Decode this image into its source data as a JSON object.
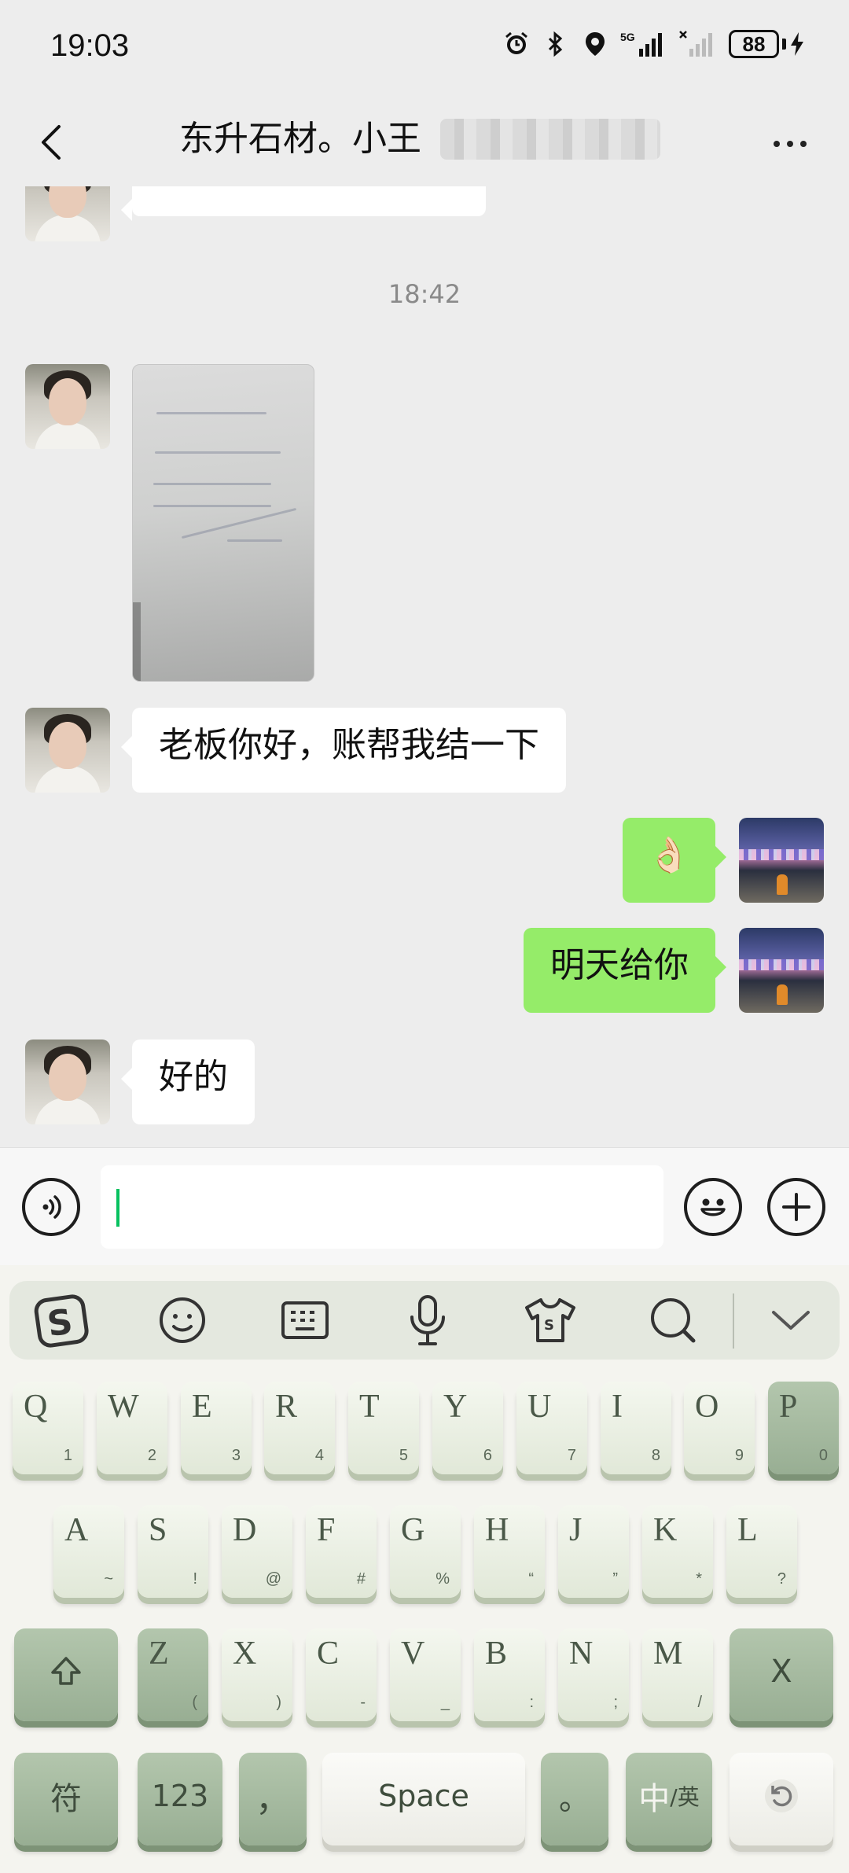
{
  "status_bar": {
    "time": "19:03",
    "battery": "88",
    "network": "5G"
  },
  "header": {
    "title": "东升石材。小王"
  },
  "chat": {
    "timestamp": "18:42",
    "messages": [
      {
        "side": "left",
        "type": "image",
        "content": "handwritten receipt photo"
      },
      {
        "side": "left",
        "type": "text",
        "text": "老板你好，账帮我结一下"
      },
      {
        "side": "right",
        "type": "emoji",
        "text": "👌🏻"
      },
      {
        "side": "right",
        "type": "text",
        "text": "明天给你"
      },
      {
        "side": "left",
        "type": "text",
        "text": "好的"
      }
    ]
  },
  "input_bar": {
    "value": "",
    "placeholder": ""
  },
  "keyboard": {
    "row1": [
      {
        "main": "Q",
        "sub": "1"
      },
      {
        "main": "W",
        "sub": "2"
      },
      {
        "main": "E",
        "sub": "3"
      },
      {
        "main": "R",
        "sub": "4"
      },
      {
        "main": "T",
        "sub": "5"
      },
      {
        "main": "Y",
        "sub": "6"
      },
      {
        "main": "U",
        "sub": "7"
      },
      {
        "main": "I",
        "sub": "8"
      },
      {
        "main": "O",
        "sub": "9"
      },
      {
        "main": "P",
        "sub": "0"
      }
    ],
    "row2": [
      {
        "main": "A",
        "sub": "~"
      },
      {
        "main": "S",
        "sub": "!"
      },
      {
        "main": "D",
        "sub": "@"
      },
      {
        "main": "F",
        "sub": "#"
      },
      {
        "main": "G",
        "sub": "%"
      },
      {
        "main": "H",
        "sub": "“"
      },
      {
        "main": "J",
        "sub": "”"
      },
      {
        "main": "K",
        "sub": "*"
      },
      {
        "main": "L",
        "sub": "?"
      }
    ],
    "row3": [
      {
        "main": "Z",
        "sub": "("
      },
      {
        "main": "X",
        "sub": ")"
      },
      {
        "main": "C",
        "sub": "-"
      },
      {
        "main": "V",
        "sub": "_"
      },
      {
        "main": "B",
        "sub": ":"
      },
      {
        "main": "N",
        "sub": ";"
      },
      {
        "main": "M",
        "sub": "/"
      }
    ],
    "symbols_label": "符",
    "numbers_label": "123",
    "comma_label": "，",
    "space_label": "Space",
    "period_label": "。",
    "lang_main": "中",
    "lang_sub": "/英",
    "delete_label": "X"
  },
  "colors": {
    "my_bubble": "#95ec69",
    "their_bubble": "#ffffff",
    "background": "#ededed",
    "caret": "#07c160"
  }
}
